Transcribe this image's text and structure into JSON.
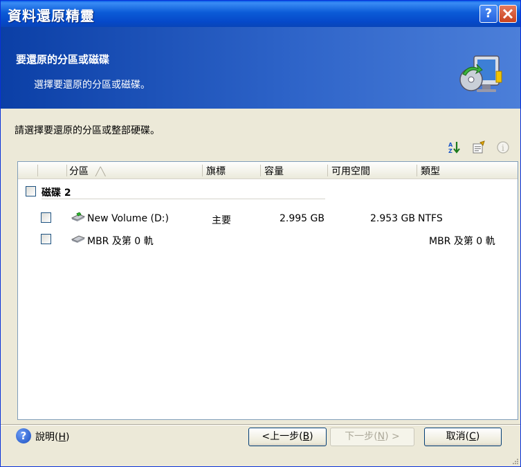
{
  "window": {
    "title": "資料還原精靈"
  },
  "header": {
    "title": "要還原的分區或磁碟",
    "subtitle": "選擇要還原的分區或磁碟。"
  },
  "instruction": "請選擇要還原的分區或整部硬碟。",
  "columns": [
    "分區",
    "旗標",
    "容量",
    "可用空間",
    "類型"
  ],
  "disk": {
    "label": "磁碟 2"
  },
  "rows": [
    {
      "name": "New Volume (D:)",
      "flag": "主要",
      "capacity": "2.995 GB",
      "free": "2.953 GB",
      "type": "NTFS"
    },
    {
      "name": "MBR 及第 0 軌",
      "flag": "",
      "capacity": "",
      "free": "",
      "type": "MBR 及第 0 軌"
    }
  ],
  "footer": {
    "help_label": "說明",
    "help_key": "H",
    "back_label": "<上一步",
    "back_key": "B",
    "next_label": "下一步",
    "next_key": "N",
    "next_suffix": " >",
    "cancel_label": "取消",
    "cancel_key": "C"
  },
  "icons": [
    "help-titlebar-icon",
    "close-icon",
    "restore-wizard-icon",
    "sort-icon",
    "properties-icon",
    "info-icon",
    "help-icon",
    "drive-icon"
  ]
}
